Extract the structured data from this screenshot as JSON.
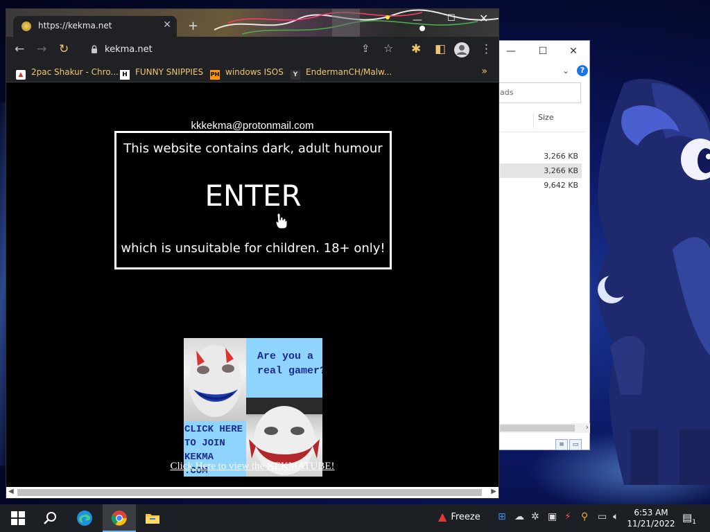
{
  "browser": {
    "tab_title": "https://kekma.net",
    "tab_close": "✕",
    "new_tab": "+",
    "url": "kekma.net",
    "bookmarks": [
      {
        "label": "2pac Shakur - Chro..."
      },
      {
        "label": "FUNNY SNIPPIES",
        "icon_text": "H"
      },
      {
        "label": "windows ISOS",
        "icon_text": "PH"
      },
      {
        "label": "EndermanCH/Malw...",
        "icon_text": "Y"
      }
    ],
    "bookmarks_more": "»"
  },
  "page": {
    "email": "kkkekma@protonmail.com",
    "warning_top": "This website contains dark, adult humour",
    "enter_label": "ENTER",
    "warning_bottom": "which is unsuitable for children. 18+ only!",
    "banner_question": "Are you a\nreal gamer?",
    "banner_join": "CLICK HERE\nTO JOIN\nKEKMA\n.COM",
    "kekmatube_link": "Click Here to view the KEKMATUBE!"
  },
  "explorer": {
    "search_placeholder": "ads",
    "col_size": "Size",
    "rows": [
      "3,266 KB",
      "3,266 KB",
      "9,642 KB"
    ]
  },
  "taskbar": {
    "freeze_label": "Freeze",
    "time": "6:53 AM",
    "date": "11/21/2022",
    "notification_count": "1"
  },
  "colors": {
    "bookmark_text": "#f0c674",
    "chrome_dark": "#202124",
    "banner_blue": "#8fd3ff",
    "taskbar": "#1c1f24"
  }
}
